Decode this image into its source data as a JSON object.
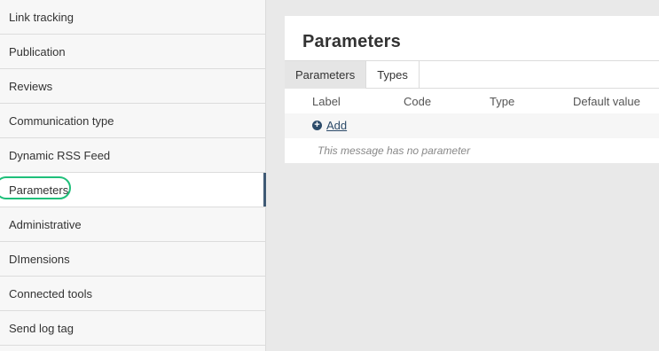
{
  "sidebar": {
    "items": [
      {
        "label": "Link tracking"
      },
      {
        "label": "Publication"
      },
      {
        "label": "Reviews"
      },
      {
        "label": "Communication type"
      },
      {
        "label": "Dynamic RSS Feed"
      },
      {
        "label": "Parameters"
      },
      {
        "label": "Administrative"
      },
      {
        "label": "DImensions"
      },
      {
        "label": "Connected tools"
      },
      {
        "label": "Send log tag"
      }
    ],
    "active_index": 5
  },
  "panel": {
    "title": "Parameters",
    "tabs": [
      {
        "label": "Parameters",
        "active": true
      },
      {
        "label": "Types",
        "active": false
      }
    ],
    "table": {
      "columns": [
        "Label",
        "Code",
        "Type",
        "Default value"
      ],
      "add_label": "Add",
      "empty_message": "This message has no parameter"
    }
  },
  "colors": {
    "accent": "#3f5a75",
    "link": "#2b4a69",
    "highlight_ring": "#1fbf7a",
    "background": "#e9e9e9"
  },
  "icons": {
    "add": "plus-circle-icon"
  }
}
